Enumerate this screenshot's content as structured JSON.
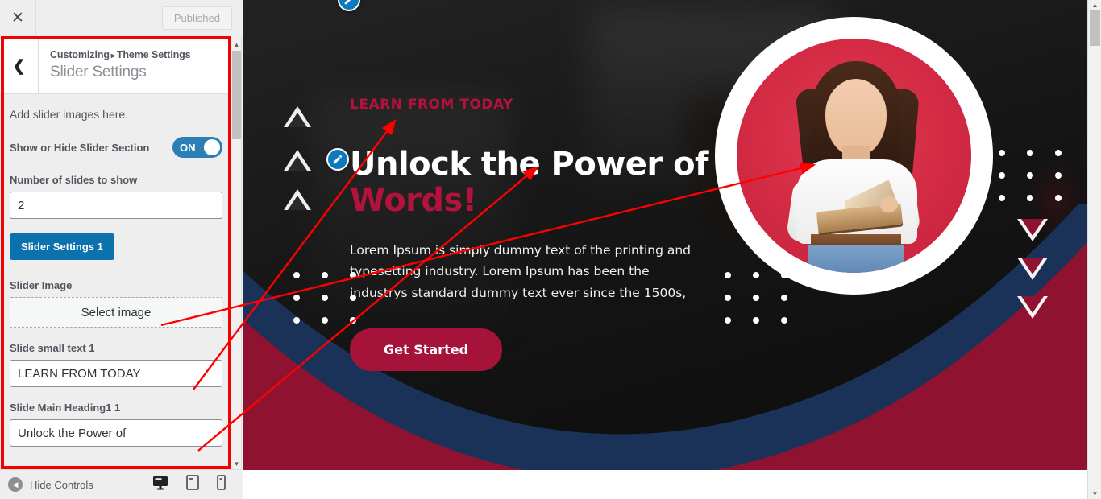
{
  "customizer": {
    "close_icon": "close-icon",
    "publish_button": "Published",
    "back_icon": "chevron-left-icon",
    "breadcrumb_root": "Customizing",
    "breadcrumb_sep": "▸",
    "breadcrumb_parent": "Theme Settings",
    "panel_title": "Slider Settings",
    "description": "Add slider images here.",
    "controls": {
      "toggle_label": "Show or Hide Slider Section",
      "toggle_state": "ON",
      "slides_label": "Number of slides to show",
      "slides_value": "2",
      "settings_button": "Slider Settings 1",
      "image_label": "Slider Image",
      "select_image_button": "Select image",
      "small_text_label": "Slide small text 1",
      "small_text_value": "LEARN FROM TODAY",
      "heading_label": "Slide Main Heading1 1",
      "heading_value": "Unlock the Power of"
    },
    "bottom": {
      "hide_controls": "Hide Controls",
      "devices": [
        {
          "name": "desktop-preview-icon",
          "active": true
        },
        {
          "name": "tablet-preview-icon",
          "active": false
        },
        {
          "name": "mobile-preview-icon",
          "active": false
        }
      ]
    },
    "accent_color": "#0b72ad",
    "highlight_color": "#f50000"
  },
  "preview": {
    "slide": {
      "small_text": "LEARN FROM TODAY",
      "heading_line1": "Unlock the Power of",
      "heading_line2": "Words!",
      "paragraph": "Lorem Ipsum is simply dummy text of the printing and typesetting industry. Lorem Ipsum has been the industrys standard dummy text ever since the 1500s,",
      "cta_button": "Get Started"
    },
    "colors": {
      "crimson": "#a5123a",
      "navy": "#1b3258",
      "circle_red": "#d62d46",
      "heading_white": "#ffffff",
      "heading_accent": "#b3123c"
    },
    "decorations": {
      "triangles_up": 3,
      "triangles_down": 3,
      "dot_grid_cells": 9,
      "dot_grids": 3
    },
    "edit_pencils": 2
  }
}
